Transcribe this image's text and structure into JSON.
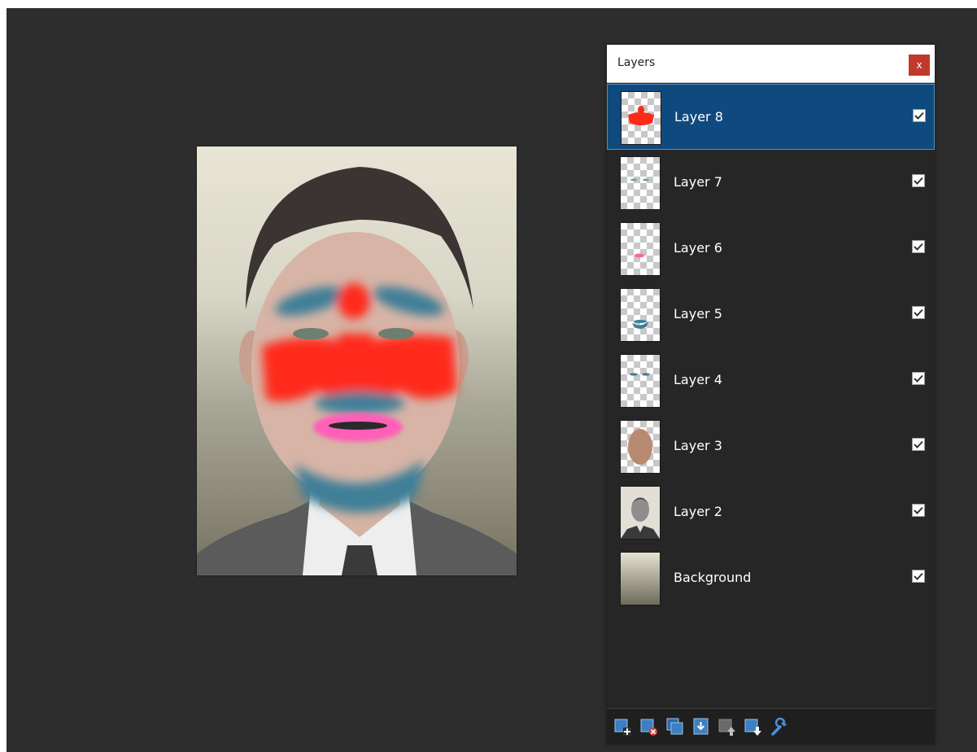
{
  "panel": {
    "title": "Layers",
    "close_label": "x"
  },
  "layers": [
    {
      "name": "Layer 8",
      "selected": true,
      "visible": true,
      "thumb": "red-paint-thumb-icon"
    },
    {
      "name": "Layer 7",
      "selected": false,
      "visible": true,
      "thumb": "eye-marks-thumb-icon"
    },
    {
      "name": "Layer 6",
      "selected": false,
      "visible": true,
      "thumb": "pink-lips-thumb-icon"
    },
    {
      "name": "Layer 5",
      "selected": false,
      "visible": true,
      "thumb": "blue-chin-thumb-icon"
    },
    {
      "name": "Layer 4",
      "selected": false,
      "visible": true,
      "thumb": "blue-brows-thumb-icon"
    },
    {
      "name": "Layer 3",
      "selected": false,
      "visible": true,
      "thumb": "face-skin-thumb-icon"
    },
    {
      "name": "Layer 2",
      "selected": false,
      "visible": true,
      "thumb": "portrait-thumb-icon"
    },
    {
      "name": "Background",
      "selected": false,
      "visible": true,
      "thumb": "background-gradient-thumb-icon"
    }
  ],
  "toolbar": [
    {
      "name": "add-layer-icon"
    },
    {
      "name": "delete-layer-icon"
    },
    {
      "name": "duplicate-layer-icon"
    },
    {
      "name": "merge-down-icon"
    },
    {
      "name": "move-layer-up-icon"
    },
    {
      "name": "move-layer-down-icon"
    },
    {
      "name": "layer-properties-icon"
    }
  ],
  "colors": {
    "workspace": "#2d2d2d",
    "panel": "#262626",
    "selected_row": "#0f4a7e",
    "close_button": "#c0392b",
    "paint_red": "#ff2a1a",
    "paint_blue": "#3f7f98",
    "paint_pink": "#ff5fb8"
  }
}
